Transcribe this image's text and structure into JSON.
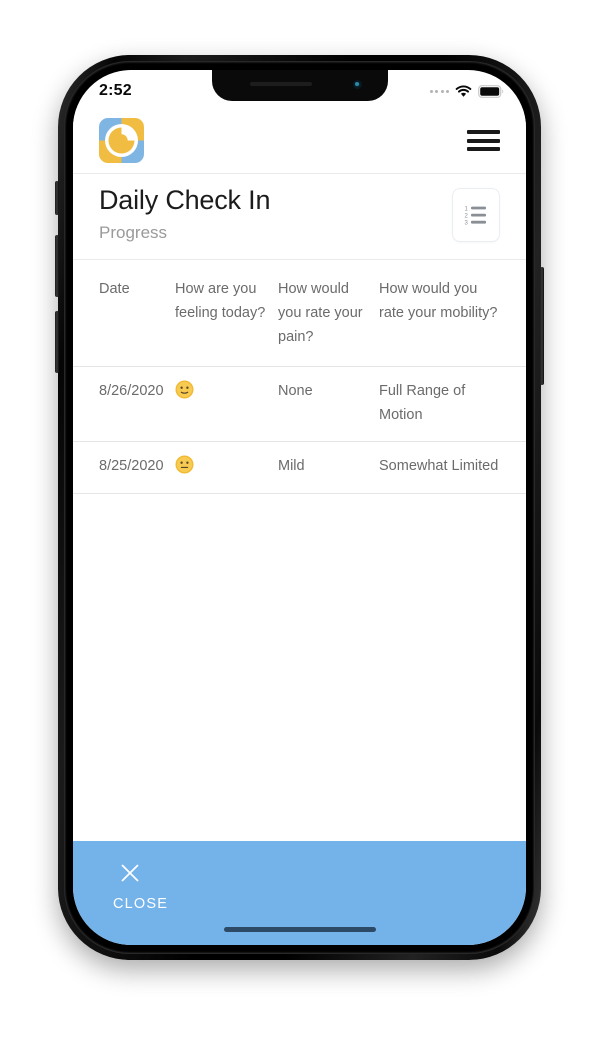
{
  "status_bar": {
    "time": "2:52",
    "signal_icon": "signal-dots-icon",
    "wifi_icon": "wifi-icon",
    "battery_icon": "battery-full-icon"
  },
  "app_header": {
    "logo_icon": "app-logo-icon",
    "logo_colors": {
      "blue": "#7fb5e3",
      "yellow": "#f0bd42",
      "ring": "#ffffff"
    },
    "menu_icon": "hamburger-menu-icon"
  },
  "page": {
    "title": "Daily Check In",
    "subtitle": "Progress",
    "list_button_icon": "numbered-list-icon"
  },
  "table": {
    "columns": [
      "Date",
      "How are you feeling today?",
      "How would you rate your pain?",
      "How would you rate your mobility?"
    ],
    "rows": [
      {
        "date": "8/26/2020",
        "feeling_icon": "neutral-face-emoji",
        "pain": "None",
        "mobility": "Full Range of Motion"
      },
      {
        "date": "8/25/2020",
        "feeling_icon": "neutral-face-emoji",
        "pain": "Mild",
        "mobility": "Somewhat Limited"
      }
    ]
  },
  "footer": {
    "close_icon": "close-x-icon",
    "close_label": "CLOSE",
    "background_color": "#74b2ea",
    "home_indicator": "home-indicator"
  }
}
